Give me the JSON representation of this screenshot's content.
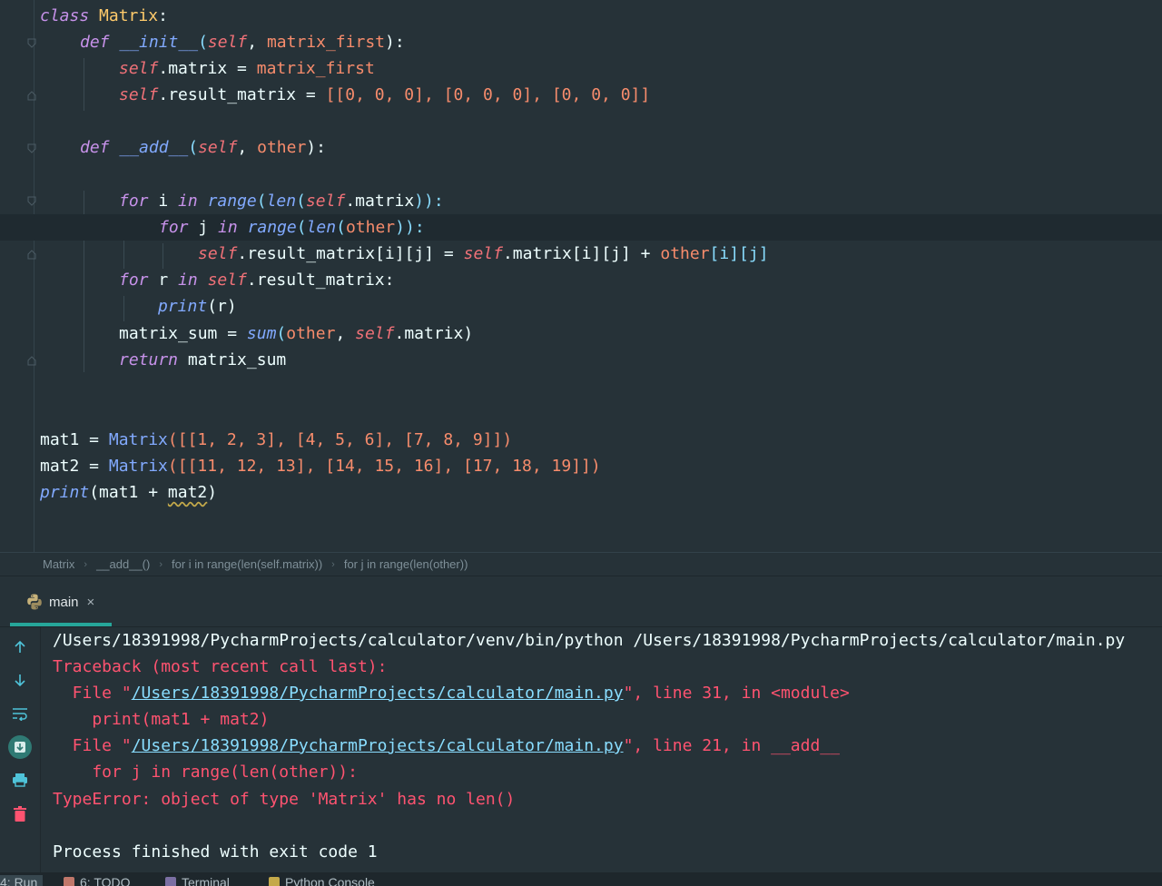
{
  "editor": {
    "code": {
      "l1": {
        "kw": "class",
        "cls": "Matrix",
        "colon": ":"
      },
      "l2": {
        "kw": "def",
        "fn": "__init__",
        "open": "(",
        "self": "self",
        "comma": ", ",
        "param": "matrix_first",
        "close": "):"
      },
      "l3": {
        "self": "self",
        "rest": ".matrix = ",
        "val": "matrix_first"
      },
      "l4": {
        "self": "self",
        "rest": ".result_matrix = ",
        "val": "[[0, 0, 0], [0, 0, 0], [0, 0, 0]]"
      },
      "l5": {
        "kw": "def",
        "fn": "__add__",
        "open": "(",
        "self": "self",
        "comma": ", ",
        "param": "other",
        "close": "):"
      },
      "l6": {
        "kw": "for",
        "var": " i ",
        "in": "in",
        "sp": " ",
        "fn": "range",
        "p1": "(",
        "fn2": "len",
        "p2": "(",
        "self": "self",
        "rest": ".matrix",
        "close": ")):"
      },
      "l7": {
        "kw": "for",
        "var": " j ",
        "in": "in",
        "sp": " ",
        "fn": "range",
        "p1": "(",
        "fn2": "len",
        "p2": "(",
        "other": "other",
        "close": ")):"
      },
      "l8": {
        "self": "self",
        "rest": ".result_matrix[i][j] = ",
        "self2": "self",
        "rest2": ".matrix[i][j] + ",
        "other": "other",
        "rest3": "[i][j]"
      },
      "l9": {
        "kw": "for",
        "var": " r ",
        "in": "in",
        "sp": " ",
        "self": "self",
        "rest": ".result_matrix:"
      },
      "l10": {
        "fn": "print",
        "rest": "(r)"
      },
      "l11": {
        "var": "matrix_sum = ",
        "fn": "sum",
        "open": "(",
        "other": "other",
        "comma": ", ",
        "self": "self",
        "rest": ".matrix)"
      },
      "l12": {
        "kw": "return",
        "rest": " matrix_sum"
      },
      "l13": {
        "var": "mat1 = ",
        "cls": "Matrix",
        "rest": "([[1, 2, 3], [4, 5, 6], [7, 8, 9]])"
      },
      "l14": {
        "var": "mat2 = ",
        "cls": "Matrix",
        "rest": "([[11, 12, 13], [14, 15, 16], [17, 18, 19]])"
      },
      "l15": {
        "fn": "print",
        "open": "(mat1 + ",
        "warn": "mat2",
        "close": ")"
      }
    }
  },
  "breadcrumb": [
    "Matrix",
    "__add__()",
    "for i in range(len(self.matrix))",
    "for j in range(len(other))"
  ],
  "run_panel": {
    "tab_label": "main",
    "close_glyph": "×"
  },
  "console": {
    "cmd": "/Users/18391998/PycharmProjects/calculator/venv/bin/python /Users/18391998/PycharmProjects/calculator/main.py",
    "traceback": "Traceback (most recent call last):",
    "file1_pre": "  File \"",
    "file1_link": "/Users/18391998/PycharmProjects/calculator/main.py",
    "file1_post": "\", line 31, in <module>",
    "code1": "    print(mat1 + mat2)",
    "file2_pre": "  File \"",
    "file2_link": "/Users/18391998/PycharmProjects/calculator/main.py",
    "file2_post": "\", line 21, in __add__",
    "code2": "    for j in range(len(other)):",
    "error": "TypeError: object of type 'Matrix' has no len()",
    "finished": "Process finished with exit code 1"
  },
  "bottom_bar": {
    "run": "4: Run",
    "todo": "6: TODO",
    "terminal": "Terminal",
    "python_console": "Python Console"
  },
  "colors": {
    "background": "#263238",
    "keyword": "#c792ea",
    "class": "#ffcb6b",
    "function": "#82aaff",
    "self": "#f07178",
    "number": "#f78c6c",
    "error": "#ff5370",
    "link": "#89ddff",
    "accent": "#26a69a"
  },
  "icons": [
    "python-icon",
    "close-icon",
    "up-arrow-icon",
    "down-arrow-icon",
    "soft-wrap-icon",
    "scroll-to-end-icon",
    "print-icon",
    "trash-icon",
    "todo-icon",
    "terminal-icon",
    "python-console-icon"
  ]
}
